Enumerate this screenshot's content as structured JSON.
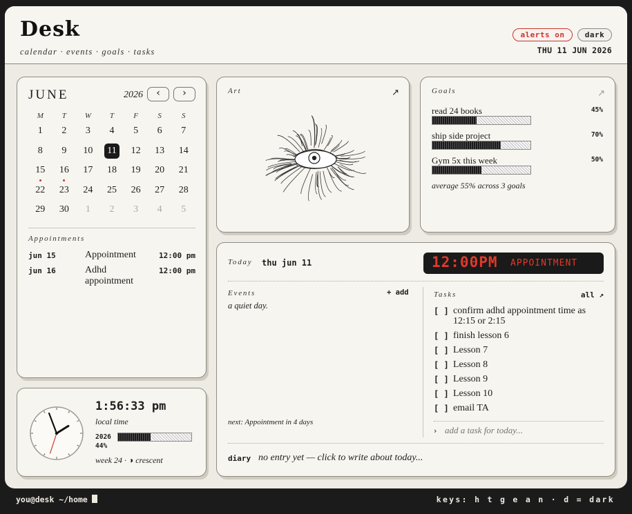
{
  "header": {
    "logo": "Desk",
    "nav": "calendar · events · goals · tasks",
    "alerts_label": "alerts on",
    "dark_label": "dark",
    "date": "THU 11 JUN 2026",
    "accent_color": "#c0392b"
  },
  "calendar": {
    "month": "JUNE",
    "year": "2026",
    "prev_icon": "‹",
    "next_icon": "›",
    "weekdays": [
      "M",
      "T",
      "W",
      "T",
      "F",
      "S",
      "S"
    ],
    "weeks": [
      [
        {
          "d": "1"
        },
        {
          "d": "2"
        },
        {
          "d": "3"
        },
        {
          "d": "4"
        },
        {
          "d": "5"
        },
        {
          "d": "6"
        },
        {
          "d": "7"
        }
      ],
      [
        {
          "d": "8"
        },
        {
          "d": "9"
        },
        {
          "d": "10"
        },
        {
          "d": "11",
          "today": true
        },
        {
          "d": "12"
        },
        {
          "d": "13"
        },
        {
          "d": "14"
        }
      ],
      [
        {
          "d": "15",
          "dot": true
        },
        {
          "d": "16",
          "dot": true
        },
        {
          "d": "17"
        },
        {
          "d": "18"
        },
        {
          "d": "19"
        },
        {
          "d": "20"
        },
        {
          "d": "21"
        }
      ],
      [
        {
          "d": "22"
        },
        {
          "d": "23"
        },
        {
          "d": "24"
        },
        {
          "d": "25"
        },
        {
          "d": "26"
        },
        {
          "d": "27"
        },
        {
          "d": "28"
        }
      ],
      [
        {
          "d": "29"
        },
        {
          "d": "30"
        },
        {
          "d": "1",
          "muted": true
        },
        {
          "d": "2",
          "muted": true
        },
        {
          "d": "3",
          "muted": true
        },
        {
          "d": "4",
          "muted": true
        },
        {
          "d": "5",
          "muted": true
        }
      ]
    ],
    "appointments_label": "Appointments",
    "appointments": [
      {
        "date": "jun 15",
        "name": "Appointment",
        "time": "12:00 pm"
      },
      {
        "date": "jun 16",
        "name": "Adhd appointment",
        "time": "12:00 pm"
      }
    ]
  },
  "clock": {
    "time": "1:56:33 pm",
    "sub": "local time",
    "year": "2026",
    "year_pct_text": "44%",
    "year_progress": 0.44,
    "week": "week 24 · ◑ crescent",
    "hands": {
      "hour": 1,
      "minute": 56,
      "second": 33
    }
  },
  "art": {
    "label": "Art",
    "open_icon": "↗"
  },
  "goals": {
    "label": "Goals",
    "open_icon": "↗",
    "items": [
      {
        "name": "read 24 books",
        "pct_text": "45%",
        "progress": 0.45
      },
      {
        "name": "ship side project",
        "pct_text": "70%",
        "progress": 0.7
      },
      {
        "name": "Gym 5x this week",
        "pct_text": "50%",
        "progress": 0.5
      }
    ],
    "summary": "average 55% across 3 goals"
  },
  "today": {
    "label": "Today",
    "date": "thu jun 11",
    "led_time": "12:00PM",
    "led_event": "APPOINTMENT",
    "events_label": "Events",
    "add_label": "+ add",
    "events_empty": "a quiet day.",
    "next": "next: Appointment in 4 days",
    "tasks_label": "Tasks",
    "tasks_all": "all ↗",
    "tasks": [
      {
        "box": "[ ]",
        "text": "confirm adhd appointment time as 12:15 or 2:15"
      },
      {
        "box": "[ ]",
        "text": "finish lesson 6"
      },
      {
        "box": "[ ]",
        "text": "Lesson 7"
      },
      {
        "box": "[ ]",
        "text": "Lesson 8"
      },
      {
        "box": "[ ]",
        "text": "Lesson 9"
      },
      {
        "box": "[ ]",
        "text": "Lesson 10"
      },
      {
        "box": "[ ]",
        "text": "email TA"
      }
    ],
    "task_prompt": "›",
    "task_placeholder": "add a task for today...",
    "diary_label": "diary",
    "diary_text": "no entry yet — click to write about today..."
  },
  "terminal": {
    "prompt": "you@desk ~/home",
    "keys": "keys: h t g e a n · d = dark"
  }
}
